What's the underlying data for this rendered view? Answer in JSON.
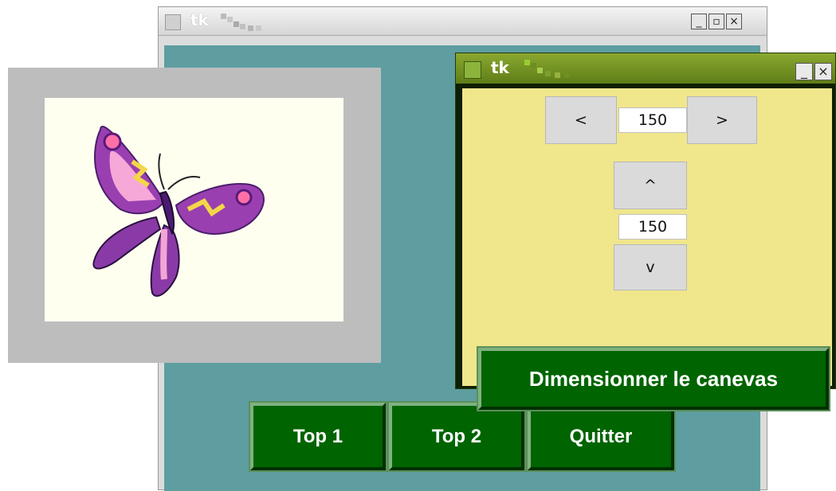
{
  "main_window": {
    "title": "tk",
    "minimize": "_",
    "maximize": "▫",
    "close": "×",
    "buttons": {
      "top1": "Top 1",
      "top2": "Top 2",
      "quit": "Quitter"
    }
  },
  "top2_window": {
    "title": "tk",
    "minimize": "_",
    "close": "×",
    "horizontal": {
      "left": "<",
      "value": "150",
      "right": ">"
    },
    "vertical": {
      "up": "^",
      "value": "150",
      "down": "v"
    },
    "resize_button": "Dimensionner le canevas"
  },
  "colors": {
    "main_bg": "#5e9ea0",
    "canvas_bg": "#fffff0",
    "panel_bg": "#f0e68c",
    "button_green": "#006400"
  }
}
